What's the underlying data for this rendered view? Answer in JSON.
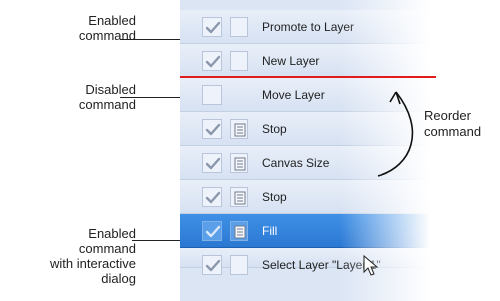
{
  "callouts": {
    "enabled": "Enabled\ncommand",
    "disabled": "Disabled\ncommand",
    "interactive": "Enabled\ncommand\nwith interactive\ndialog",
    "reorder": "Reorder\ncommand"
  },
  "actions": [
    {
      "label": "Promote to Layer",
      "checked": true,
      "dialog": false,
      "selected": false
    },
    {
      "label": "New Layer",
      "checked": true,
      "dialog": false,
      "selected": false
    },
    {
      "label": "Move Layer",
      "checked": false,
      "dialog": false,
      "selected": false
    },
    {
      "label": "Stop",
      "checked": true,
      "dialog": true,
      "selected": false
    },
    {
      "label": "Canvas Size",
      "checked": true,
      "dialog": true,
      "selected": false
    },
    {
      "label": "Stop",
      "checked": true,
      "dialog": true,
      "selected": false
    },
    {
      "label": "Fill",
      "checked": true,
      "dialog": true,
      "selected": true
    },
    {
      "label": "Select Layer \"Layer 1\"",
      "checked": true,
      "dialog": false,
      "selected": false
    }
  ],
  "colors": {
    "selection": "#2b78d3",
    "drop_indicator": "#e01c1c",
    "check": "#8b98ab"
  }
}
